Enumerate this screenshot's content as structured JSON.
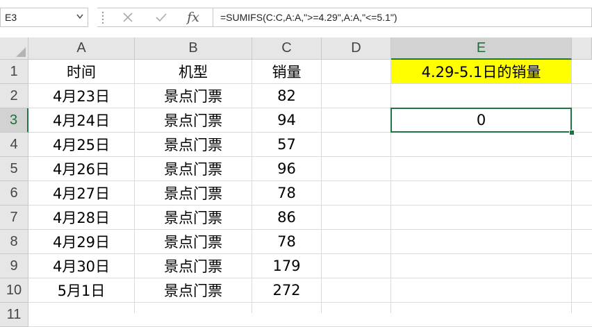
{
  "formula_bar": {
    "name_box": "E3",
    "formula": "=SUMIFS(C:C,A:A,\">=4.29\",A:A,\"<=5.1\")",
    "fx_label": "fx"
  },
  "columns": [
    "A",
    "B",
    "C",
    "D",
    "E"
  ],
  "rows": [
    "1",
    "2",
    "3",
    "4",
    "5",
    "6",
    "7",
    "8",
    "9",
    "10",
    "11"
  ],
  "selected_cell": "E3",
  "colors": {
    "selection": "#217346",
    "highlight": "#ffff00"
  },
  "sheet": {
    "headers": {
      "time": "时间",
      "model": "机型",
      "sales": "销量"
    },
    "data_rows": [
      {
        "time": "4月23日",
        "model": "景点门票",
        "sales": "82"
      },
      {
        "time": "4月24日",
        "model": "景点门票",
        "sales": "94"
      },
      {
        "time": "4月25日",
        "model": "景点门票",
        "sales": "57"
      },
      {
        "time": "4月26日",
        "model": "景点门票",
        "sales": "96"
      },
      {
        "time": "4月27日",
        "model": "景点门票",
        "sales": "78"
      },
      {
        "time": "4月28日",
        "model": "景点门票",
        "sales": "86"
      },
      {
        "time": "4月29日",
        "model": "景点门票",
        "sales": "78"
      },
      {
        "time": "4月30日",
        "model": "景点门票",
        "sales": "179"
      },
      {
        "time": "5月1日",
        "model": "景点门票",
        "sales": "272"
      }
    ],
    "e1": "4.29-5.1日的销量",
    "e3": "0"
  }
}
